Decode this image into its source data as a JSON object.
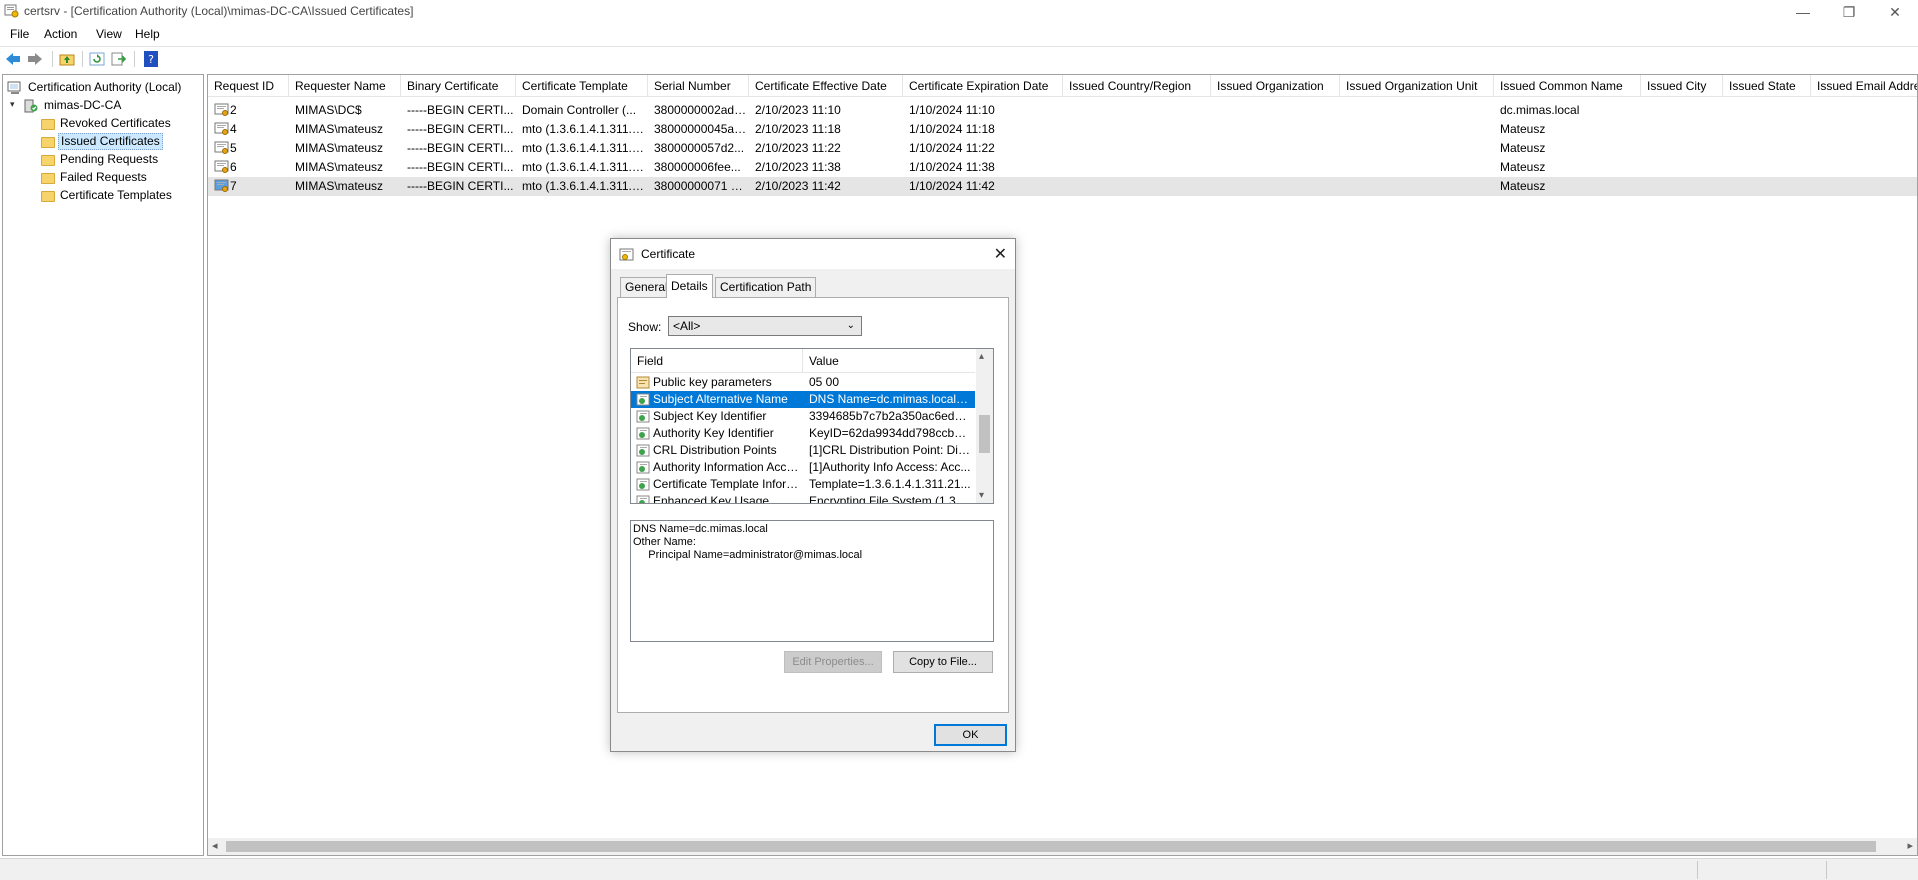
{
  "window": {
    "title": "certsrv - [Certification Authority (Local)\\mimas-DC-CA\\Issued Certificates]",
    "min_glyph": "—",
    "restore_glyph": "❐",
    "close_glyph": "✕"
  },
  "menu": [
    "File",
    "Action",
    "View",
    "Help"
  ],
  "toolbar": {
    "icons": [
      "back-arrow-icon",
      "forward-arrow-icon",
      "up-folder-icon",
      "refresh-icon",
      "export-list-icon",
      "help-icon"
    ]
  },
  "tree": {
    "root": "Certification Authority (Local)",
    "ca": "mimas-DC-CA",
    "children": [
      "Revoked Certificates",
      "Issued Certificates",
      "Pending Requests",
      "Failed Requests",
      "Certificate Templates"
    ],
    "selected": "Issued Certificates"
  },
  "list": {
    "columns": [
      "Request ID",
      "Requester Name",
      "Binary Certificate",
      "Certificate Template",
      "Serial Number",
      "Certificate Effective Date",
      "Certificate Expiration Date",
      "Issued Country/Region",
      "Issued Organization",
      "Issued Organization Unit",
      "Issued Common Name",
      "Issued City",
      "Issued State",
      "Issued Email Address"
    ],
    "rows": [
      {
        "id": "2",
        "requester": "MIMAS\\DC$",
        "binary": "-----BEGIN CERTI...",
        "template": "Domain Controller (...",
        "serial": "3800000002ade...",
        "effective": "2/10/2023 11:10",
        "expiration": "1/10/2024 11:10",
        "cn": "dc.mimas.local"
      },
      {
        "id": "4",
        "requester": "MIMAS\\mateusz",
        "binary": "-----BEGIN CERTI...",
        "template": "mto (1.3.6.1.4.1.311.2...",
        "serial": "38000000045a2...",
        "effective": "2/10/2023 11:18",
        "expiration": "1/10/2024 11:18",
        "cn": "Mateusz"
      },
      {
        "id": "5",
        "requester": "MIMAS\\mateusz",
        "binary": "-----BEGIN CERTI...",
        "template": "mto (1.3.6.1.4.1.311.2...",
        "serial": "3800000057d2...",
        "effective": "2/10/2023 11:22",
        "expiration": "1/10/2024 11:22",
        "cn": "Mateusz"
      },
      {
        "id": "6",
        "requester": "MIMAS\\mateusz",
        "binary": "-----BEGIN CERTI...",
        "template": "mto (1.3.6.1.4.1.311.2...",
        "serial": "380000006fee...",
        "effective": "2/10/2023 11:38",
        "expiration": "1/10/2024 11:38",
        "cn": "Mateusz"
      },
      {
        "id": "7",
        "requester": "MIMAS\\mateusz",
        "binary": "-----BEGIN CERTI...",
        "template": "mto (1.3.6.1.4.1.311.2...",
        "serial": "38000000071 71...",
        "effective": "2/10/2023 11:42",
        "expiration": "1/10/2024 11:42",
        "cn": "Mateusz"
      }
    ],
    "selected_row": "7"
  },
  "dialog": {
    "title": "Certificate",
    "close_glyph": "✕",
    "tabs": [
      "General",
      "Details",
      "Certification Path"
    ],
    "active_tab": "Details",
    "show_label": "Show:",
    "show_value": "<All>",
    "field_header": "Field",
    "value_header": "Value",
    "fields": [
      {
        "field": "Public key parameters",
        "value": "05 00"
      },
      {
        "field": "Subject Alternative Name",
        "value": "DNS Name=dc.mimas.local, Ot..."
      },
      {
        "field": "Subject Key Identifier",
        "value": "3394685b7c7b2a350ac6ed1b..."
      },
      {
        "field": "Authority Key Identifier",
        "value": "KeyID=62da9934dd798ccb8c..."
      },
      {
        "field": "CRL Distribution Points",
        "value": "[1]CRL Distribution Point: Distr..."
      },
      {
        "field": "Authority Information Access",
        "value": "[1]Authority Info Access: Acc..."
      },
      {
        "field": "Certificate Template Inform...",
        "value": "Template=1.3.6.1.4.1.311.21..."
      },
      {
        "field": "Enhanced Key Usage",
        "value": "Encrypting File System (1.3.6..."
      }
    ],
    "selected_field": "Subject Alternative Name",
    "detail_text": "DNS Name=dc.mimas.local\nOther Name:\n     Principal Name=administrator@mimas.local",
    "edit_properties": "Edit Properties...",
    "copy_to_file": "Copy to File...",
    "ok": "OK"
  },
  "colors": {
    "selection_blue": "#0078d7",
    "tree_selection": "#cce8ff",
    "row_selection": "#e5e5e5",
    "dialog_bg": "#f0f0f0"
  }
}
